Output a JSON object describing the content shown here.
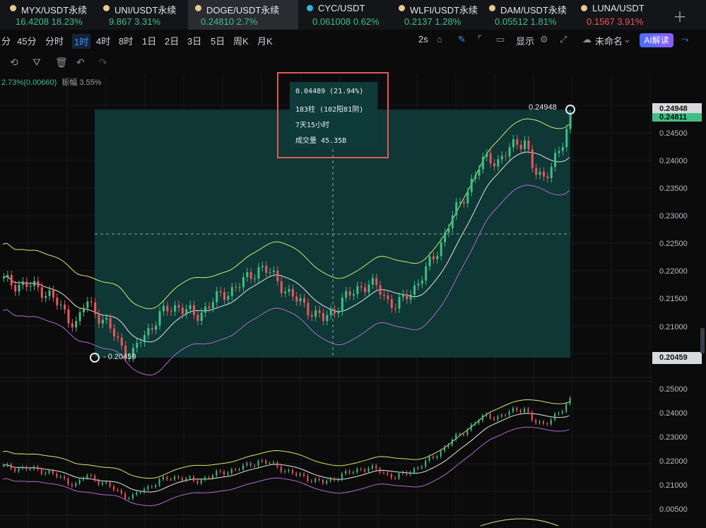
{
  "tabs": [
    {
      "name": "MYX/USDT永续",
      "price": "16.4208",
      "change": "18.23%",
      "trend": "up"
    },
    {
      "name": "UNI/USDT永续",
      "price": "9.867",
      "change": "3.31%",
      "trend": "up"
    },
    {
      "name": "DOGE/USDT永续",
      "price": "0.24810",
      "change": "2.7%",
      "trend": "up"
    },
    {
      "name": "CYC/USDT",
      "price": "0.061008",
      "change": "0.62%",
      "trend": "up"
    },
    {
      "name": "WLFI/USDT永续",
      "price": "0.2137",
      "change": "1.28%",
      "trend": "up"
    },
    {
      "name": "DAM/USDT永续",
      "price": "0.05512",
      "change": "1.81%",
      "trend": "up"
    },
    {
      "name": "LUNA/USDT",
      "price": "0.1567",
      "change": "3.91%",
      "trend": "down"
    }
  ],
  "timeframes": [
    "分",
    "45分",
    "分时",
    "1时",
    "4时",
    "8时",
    "1日",
    "2日",
    "3日",
    "5日",
    "周K",
    "月K"
  ],
  "toolbar": {
    "speed": "2s",
    "display": "显示",
    "layout_name": "未命名",
    "ai_label": "AI解读"
  },
  "info_line": {
    "change": "2.73%(0.00660)",
    "amplitude": "振幅 3.55%"
  },
  "measure": {
    "change": "0.04489 (21.94%)",
    "bars": "183柱 (102阳81阴)",
    "duration": "7天15小时",
    "volume": "成交量 45.35B",
    "high": "0.24948",
    "low": "0.20459"
  },
  "price_axis": {
    "main": [
      "0.24500",
      "0.24000",
      "0.23500",
      "0.23000",
      "0.22500",
      "0.22000",
      "0.21500",
      "0.21000"
    ],
    "high_tag": "0.24948",
    "current_tag": "0.24811",
    "low_tag": "0.20459",
    "sub": [
      "0.25000",
      "0.24000",
      "0.23000",
      "0.22000",
      "0.21000"
    ],
    "sub2": "0.00500"
  },
  "colors": {
    "up": "#3fbf86",
    "down": "#f0535d",
    "upper_band": "#d7e66a",
    "mid_band": "#e6e6e6",
    "lower_band": "#b06ad0",
    "measure_fill": "#0f3a38",
    "tip_border": "#e05a55"
  },
  "chart_data": {
    "type": "candlestick",
    "series_close": [
      0.2185,
      0.218,
      0.2178,
      0.2175,
      0.217,
      0.216,
      0.214,
      0.212,
      0.2105,
      0.215,
      0.213,
      0.211,
      0.209,
      0.2065,
      0.2046,
      0.208,
      0.21,
      0.212,
      0.2135,
      0.214,
      0.213,
      0.212,
      0.2135,
      0.215,
      0.216,
      0.217,
      0.218,
      0.2195,
      0.221,
      0.22,
      0.2185,
      0.2165,
      0.215,
      0.214,
      0.2125,
      0.2115,
      0.213,
      0.215,
      0.216,
      0.2175,
      0.218,
      0.217,
      0.215,
      0.214,
      0.2155,
      0.2175,
      0.22,
      0.2225,
      0.226,
      0.23,
      0.2325,
      0.236,
      0.239,
      0.241,
      0.24,
      0.2415,
      0.2435,
      0.244,
      0.238,
      0.237,
      0.24,
      0.242,
      0.2481
    ],
    "ylim": [
      0.203,
      0.25
    ]
  }
}
